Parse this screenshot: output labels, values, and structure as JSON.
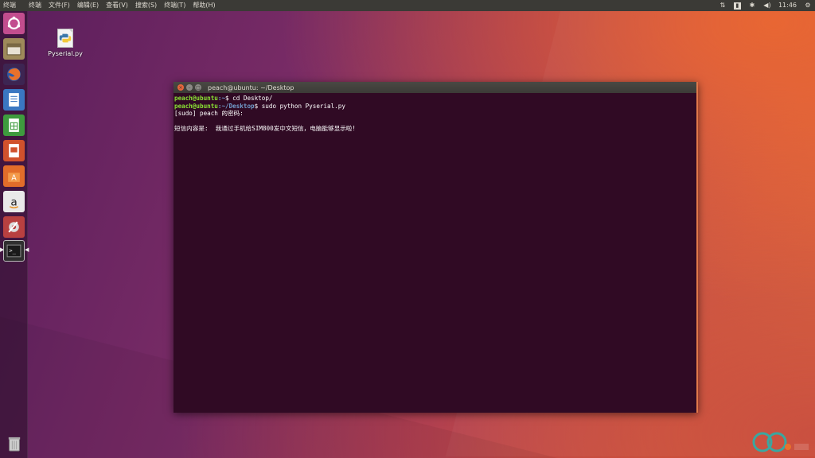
{
  "top_panel": {
    "app_name": "终端",
    "menu": [
      "终端",
      "文件(F)",
      "编辑(E)",
      "查看(V)",
      "搜索(S)",
      "终端(T)",
      "帮助(H)"
    ],
    "time": "11:46",
    "indicators": [
      "keyboard-layout-icon",
      "input-method-icon",
      "bluetooth-icon",
      "volume-icon",
      "gear-icon"
    ]
  },
  "launcher": {
    "items": [
      {
        "name": "ubuntu-dash-icon",
        "color": "#c24d8e"
      },
      {
        "name": "files-icon",
        "color": "#9e8a5a"
      },
      {
        "name": "firefox-icon",
        "color": "#e8712c"
      },
      {
        "name": "writer-icon",
        "color": "#3a77c2"
      },
      {
        "name": "calc-icon",
        "color": "#3e9b3e"
      },
      {
        "name": "impress-icon",
        "color": "#d1512c"
      },
      {
        "name": "software-center-icon",
        "color": "#e26d2a"
      },
      {
        "name": "amazon-icon",
        "color": "#e9e9e9"
      },
      {
        "name": "system-settings-icon",
        "color": "#b84040"
      },
      {
        "name": "terminal-icon",
        "color": "#2f2f2f"
      }
    ]
  },
  "desktop": {
    "file_label": "Pyserial.py"
  },
  "terminal": {
    "title": "peach@ubuntu: ~/Desktop",
    "lines": [
      {
        "user": "peach@ubuntu",
        "path": ":~",
        "rest": "$ cd Desktop/"
      },
      {
        "user": "peach@ubuntu",
        "path": ":~/Desktop",
        "rest": "$ sudo python Pyserial.py"
      },
      {
        "text": "[sudo] peach 的密码:"
      },
      {
        "text": ""
      },
      {
        "text": "短信内容是:  我通过手机给SIM800发中文短信，电脑能够显示啦!"
      }
    ]
  },
  "colors": {
    "terminal_bg": "#300a24",
    "prompt_user": "#8ae234",
    "prompt_path": "#729fcf"
  }
}
